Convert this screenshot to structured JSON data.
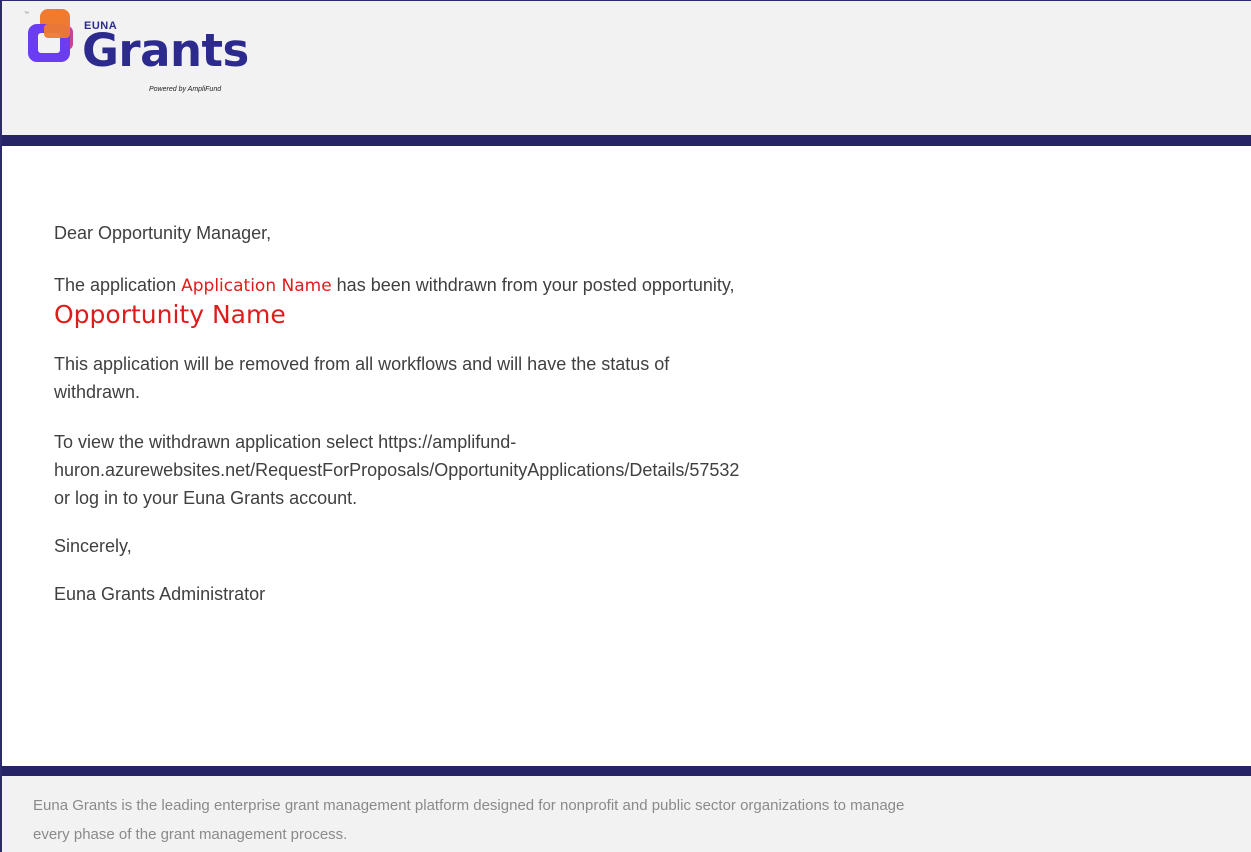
{
  "header": {
    "brand_top": "EUNA",
    "brand_main": "Grants",
    "brand_sub": "Powered by AmpliFund",
    "trademark": "™",
    "colors": {
      "brand_navy": "#2d2a8e",
      "logo_orange": "#f07a2d",
      "logo_purple": "#6b3df2",
      "bar": "#262466"
    }
  },
  "email": {
    "greeting": "Dear Opportunity Manager,",
    "app_prefix": "The application",
    "application_name": "Application Name",
    "app_suffix": "has been withdrawn from your posted opportunity,",
    "opportunity_name": "Opportunity Name",
    "removed_line": "This application will be removed from all workflows and will have the status of",
    "removed_line2": "withdrawn.",
    "view_line1": "To view the withdrawn application select https://amplifund-",
    "view_line2": "huron.azurewebsites.net/RequestForProposals/OpportunityApplications/Details/57532",
    "view_line3": "or log in to your Euna Grants account.",
    "closing": "Sincerely,",
    "signature": "Euna Grants Administrator",
    "highlight_color": "#e01b1b"
  },
  "footer": {
    "line1": "Euna Grants is the leading enterprise grant management platform designed for nonprofit and public sector organizations to manage",
    "line2": "every phase of the grant management process."
  }
}
